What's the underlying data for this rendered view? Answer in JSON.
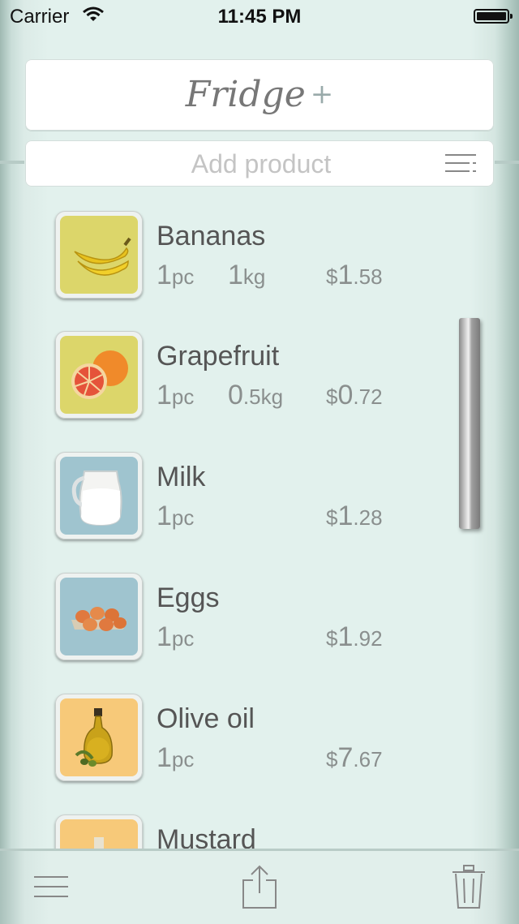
{
  "status_bar": {
    "carrier": "Carrier",
    "time": "11:45 PM"
  },
  "header": {
    "logo_text": "Fridge",
    "logo_plus": "+"
  },
  "add_product": {
    "placeholder": "Add product",
    "value": ""
  },
  "products": [
    {
      "name": "Bananas",
      "qty_num": "1",
      "qty_unit": "pc",
      "weight_num": "1",
      "weight_unit": "kg",
      "price_sign": "$",
      "price_int": "1",
      "price_dec": ".58",
      "icon": "banana-icon",
      "bg_color": "#dcd66a"
    },
    {
      "name": "Grapefruit",
      "qty_num": "1",
      "qty_unit": "pc",
      "weight_num": "0",
      "weight_unit": ".5kg",
      "price_sign": "$",
      "price_int": "0",
      "price_dec": ".72",
      "icon": "grapefruit-icon",
      "bg_color": "#dcd66a"
    },
    {
      "name": "Milk",
      "qty_num": "1",
      "qty_unit": "pc",
      "weight_num": "",
      "weight_unit": "",
      "price_sign": "$",
      "price_int": "1",
      "price_dec": ".28",
      "icon": "milk-icon",
      "bg_color": "#9fc4cf"
    },
    {
      "name": "Eggs",
      "qty_num": "1",
      "qty_unit": "pc",
      "weight_num": "",
      "weight_unit": "",
      "price_sign": "$",
      "price_int": "1",
      "price_dec": ".92",
      "icon": "eggs-icon",
      "bg_color": "#9fc4cf"
    },
    {
      "name": "Olive oil",
      "qty_num": "1",
      "qty_unit": "pc",
      "weight_num": "",
      "weight_unit": "",
      "price_sign": "$",
      "price_int": "7",
      "price_dec": ".67",
      "icon": "olive-oil-icon",
      "bg_color": "#f7c979"
    },
    {
      "name": "Mustard",
      "qty_num": "",
      "qty_unit": "",
      "weight_num": "",
      "weight_unit": "",
      "price_sign": "",
      "price_int": "",
      "price_dec": "",
      "icon": "mustard-icon",
      "bg_color": "#f7c979"
    }
  ],
  "toolbar": {
    "menu_icon": "menu-icon",
    "share_icon": "share-icon",
    "trash_icon": "trash-icon"
  }
}
